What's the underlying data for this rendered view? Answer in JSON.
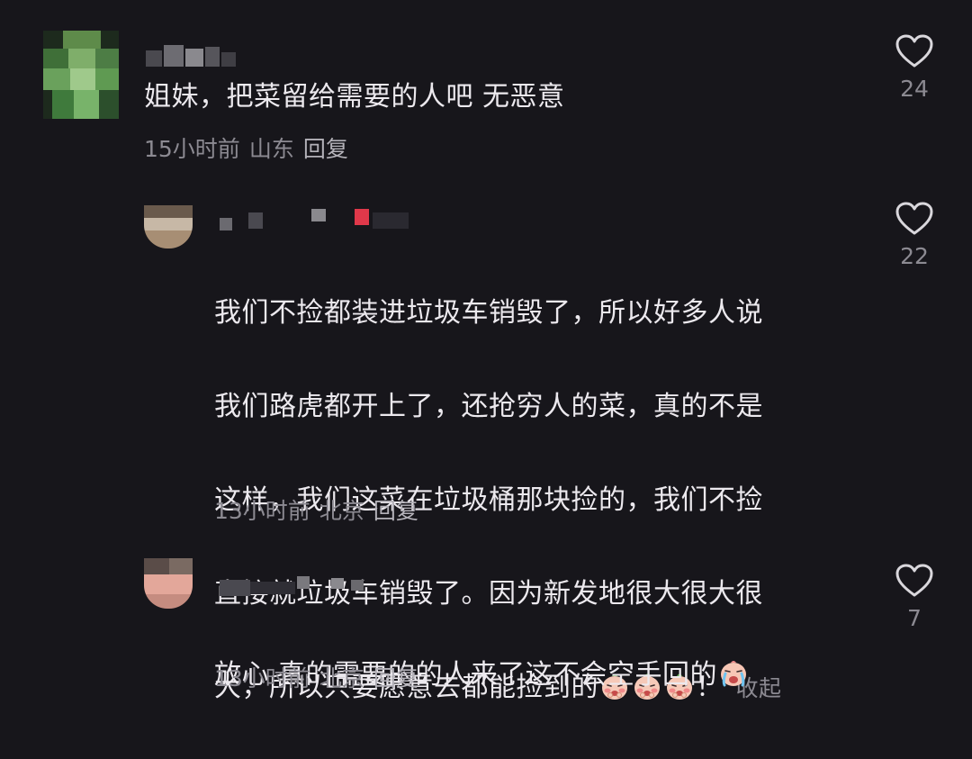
{
  "comments": [
    {
      "text": "姐妹，把菜留给需要的人吧  无恶意",
      "time": "15小时前",
      "location": "山东",
      "reply_label": "回复",
      "likes": "24"
    },
    {
      "text_lines": [
        "我们不捡都装进垃圾车销毁了，所以好多人说",
        "我们路虎都开上了，还抢穷人的菜，真的不是",
        "这样，我们这菜在垃圾桶那块捡的，我们不捡",
        "直接就垃圾车销毁了。因为新发地很大很大很",
        "大，所以只要愿意去都能捡到的"
      ],
      "text_end": "！",
      "collapse_label": "收起",
      "time": "13小时前",
      "location": "北京",
      "reply_label": "回复",
      "likes": "22"
    },
    {
      "text": "放心 真的需要的的人来了这不会空手回的",
      "time": "13小时前",
      "location": "北京",
      "reply_label": "回复",
      "likes": "7"
    }
  ],
  "icons": {
    "like": "heart-outline-icon",
    "emoji_a": "shy-peach-face-emoji",
    "emoji_b": "crying-face-emoji"
  },
  "colors": {
    "background": "#17161b",
    "text": "#ece9ee",
    "meta": "#8c8a92"
  }
}
